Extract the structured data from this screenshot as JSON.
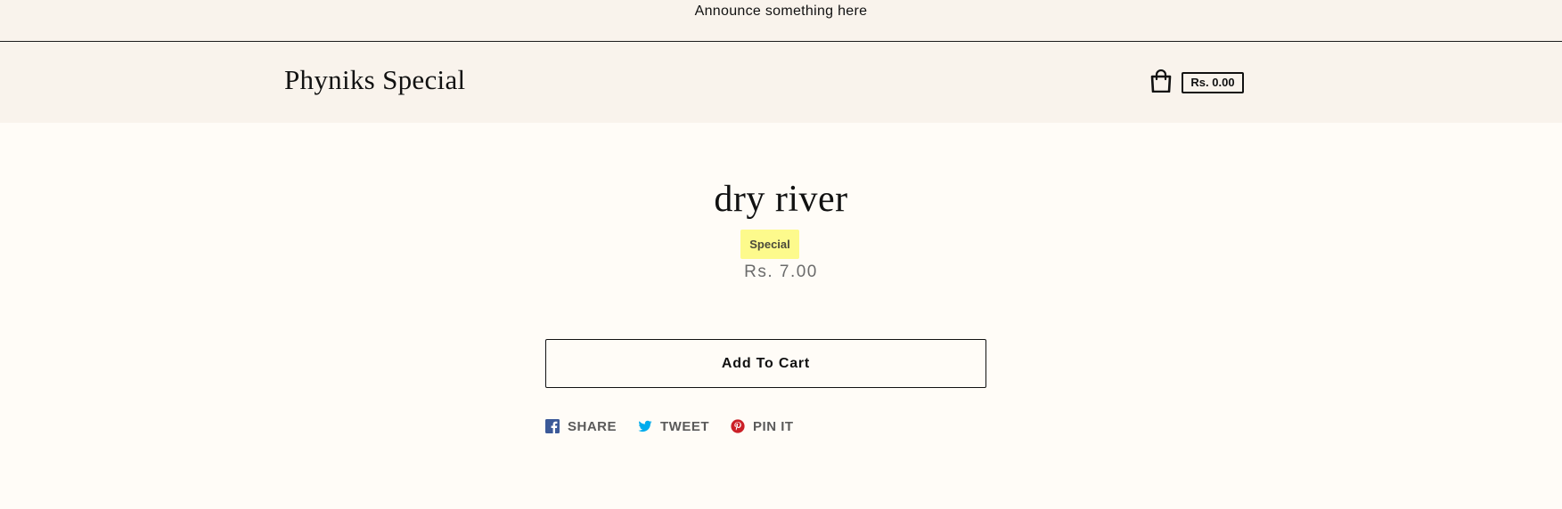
{
  "announcement": {
    "text": "Announce something here"
  },
  "header": {
    "logo": "Phyniks Special",
    "cart_total": "Rs. 0.00",
    "cart_icon": "shopping-bag-icon"
  },
  "product": {
    "title": "dry river",
    "badge": "Special",
    "price": "Rs. 7.00",
    "add_to_cart_label": "Add To Cart"
  },
  "share": {
    "facebook_label": "SHARE",
    "twitter_label": "TWEET",
    "pinterest_label": "PIN IT"
  },
  "colors": {
    "background": "#fffcf7",
    "header_background": "#f9f3ec",
    "badge_background": "#fdfa8c",
    "facebook": "#3b5998",
    "twitter": "#00aced",
    "pinterest": "#cb2027"
  }
}
